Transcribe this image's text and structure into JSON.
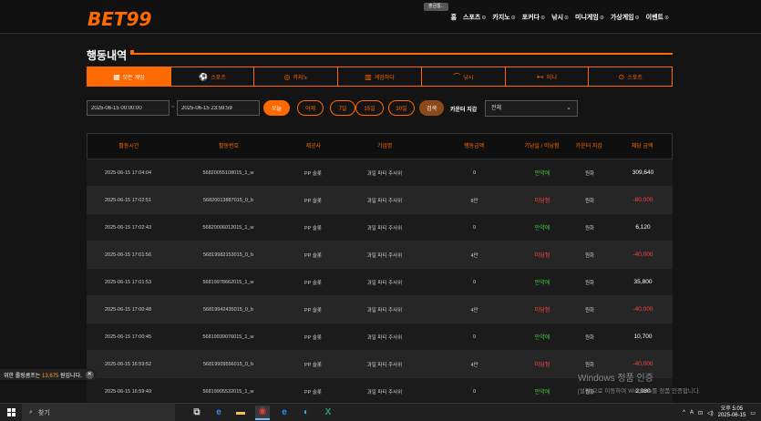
{
  "header": {
    "logo_bet": "BET",
    "logo_num": "99",
    "notice_pill": "출금통..",
    "nav": [
      {
        "label": "홈",
        "chevron": false
      },
      {
        "label": "스포츠",
        "chevron": true
      },
      {
        "label": "카지노",
        "chevron": true
      },
      {
        "label": "포커다",
        "chevron": true
      },
      {
        "label": "낚시",
        "chevron": true
      },
      {
        "label": "미니게임",
        "chevron": true
      },
      {
        "label": "가상게임",
        "chevron": true
      },
      {
        "label": "이벤트",
        "chevron": true
      }
    ]
  },
  "page": {
    "title": "행동내역"
  },
  "categories": [
    {
      "label": "모든 게임",
      "icon": "grid-icon",
      "active": true
    },
    {
      "label": "스포츠",
      "icon": "soccer-ball-icon",
      "active": false
    },
    {
      "label": "카지노",
      "icon": "casino-chip-icon",
      "active": false
    },
    {
      "label": "게임하다",
      "icon": "slot-machine-icon",
      "active": false
    },
    {
      "label": "낚시",
      "icon": "fishing-icon",
      "active": false
    },
    {
      "label": "미니",
      "icon": "gamepad-icon",
      "active": false
    },
    {
      "label": "스포츠",
      "icon": "vr-sports-icon",
      "active": false
    }
  ],
  "filters": {
    "start_date": "2025-06-15 00:00:00",
    "separator": "~",
    "end_date": "2025-06-15 23:59:59",
    "ranges": [
      {
        "label": "오늘",
        "active": true
      },
      {
        "label": "어제",
        "active": false
      },
      {
        "label": "7일",
        "active": false
      },
      {
        "label": "15일",
        "active": false
      },
      {
        "label": "30일",
        "active": false
      }
    ],
    "search_label": "검색",
    "currency_label": "카운터 지갑",
    "currency_value": "전체"
  },
  "table": {
    "headers": [
      "활동시간",
      "활동번호",
      "제공사",
      "기업명",
      "행동금액",
      "기낭일 / 미낭첨",
      "카운터 지갑",
      "체당 금액"
    ],
    "rows": [
      [
        "2025-06-15 17:04:04",
        "56820055108015_1_w",
        "PP 슬롯",
        "과일 파티 주사위",
        "0",
        "만약에",
        "원화",
        "309,640"
      ],
      [
        "2025-06-15 17:02:51",
        "56820013887015_0_b",
        "PP 슬롯",
        "과일 파티 주사위",
        "8만",
        "미당첨",
        "원화",
        "-80,000"
      ],
      [
        "2025-06-15 17:02:43",
        "56820006012015_1_w",
        "PP 슬롯",
        "과일 파티 주사위",
        "0",
        "만약에",
        "원화",
        "6,120"
      ],
      [
        "2025-06-15 17:01:56",
        "56819982153015_0_b",
        "PP 슬롯",
        "과일 파티 주사위",
        "4만",
        "미당첨",
        "원화",
        "-40,000"
      ],
      [
        "2025-06-15 17:01:53",
        "56819978662015_1_w",
        "PP 슬롯",
        "과일 파티 주사위",
        "0",
        "만약에",
        "원화",
        "35,800"
      ],
      [
        "2025-06-15 17:00:48",
        "56819942435015_0_b",
        "PP 슬롯",
        "과일 파티 주사위",
        "4만",
        "미당첨",
        "원화",
        "-40,000"
      ],
      [
        "2025-06-15 17:00:45",
        "56819939076015_1_w",
        "PP 슬롯",
        "과일 파티 주사위",
        "0",
        "만약에",
        "원화",
        "10,700"
      ],
      [
        "2025-06-15 16:59:52",
        "56819909556015_0_b",
        "PP 슬롯",
        "과일 파티 주사위",
        "4만",
        "미당첨",
        "원화",
        "-40,000"
      ],
      [
        "2025-06-15 16:59:49",
        "56819905532015_1_w",
        "PP 슬롯",
        "과일 파티 주사위",
        "0",
        "만약에",
        "원화",
        "2,080"
      ]
    ]
  },
  "toast": {
    "prefix": "위한 롤링콤프는 ",
    "amount": "13,675",
    "suffix": " 원입니다."
  },
  "watermark": {
    "line1": "Windows 정품 인증",
    "line2": "[설정]으로 이동하여 Windows를 정품 인증합니다."
  },
  "taskbar": {
    "search_placeholder": "찾기",
    "tray_lang": "A",
    "time": "오후 5:05",
    "date": "2025-06-15"
  },
  "colors": {
    "accent": "#ff6a00",
    "win": "#3ecf3e",
    "lose": "#ff4444"
  }
}
